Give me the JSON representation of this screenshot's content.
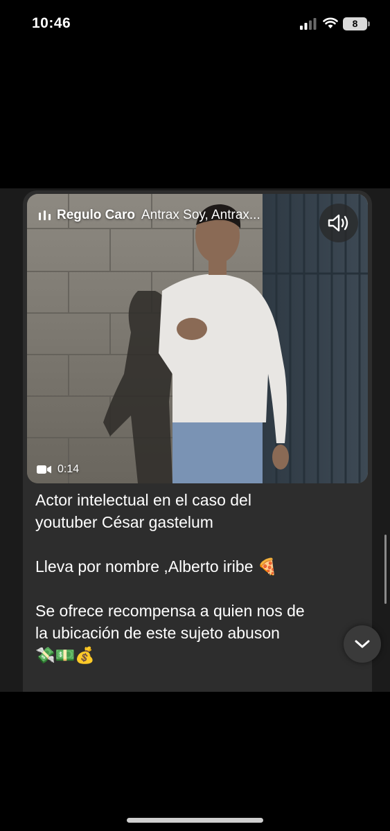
{
  "status_bar": {
    "time": "10:46",
    "battery_level": "8"
  },
  "post": {
    "music": {
      "artist": "Regulo Caro",
      "song": "Antrax Soy, Antrax...",
      "icon": "music-bars-icon"
    },
    "sound_icon": "speaker-volume-icon",
    "video_duration": "0:14",
    "video_icon": "video-camera-icon",
    "caption": {
      "line1": "Actor intelectual en el caso del",
      "line2": "youtuber César gastelum",
      "line3": "Lleva por nombre ,Alberto iribe 🍕",
      "line4": "Se ofrece recompensa a quien nos de",
      "line5": "la ubicación de este sujeto abuson",
      "line6": "💸💵💰"
    },
    "expand_icon": "chevron-down-icon"
  },
  "colors": {
    "background": "#000000",
    "card": "#2d2d2d",
    "text": "#ffffff"
  }
}
